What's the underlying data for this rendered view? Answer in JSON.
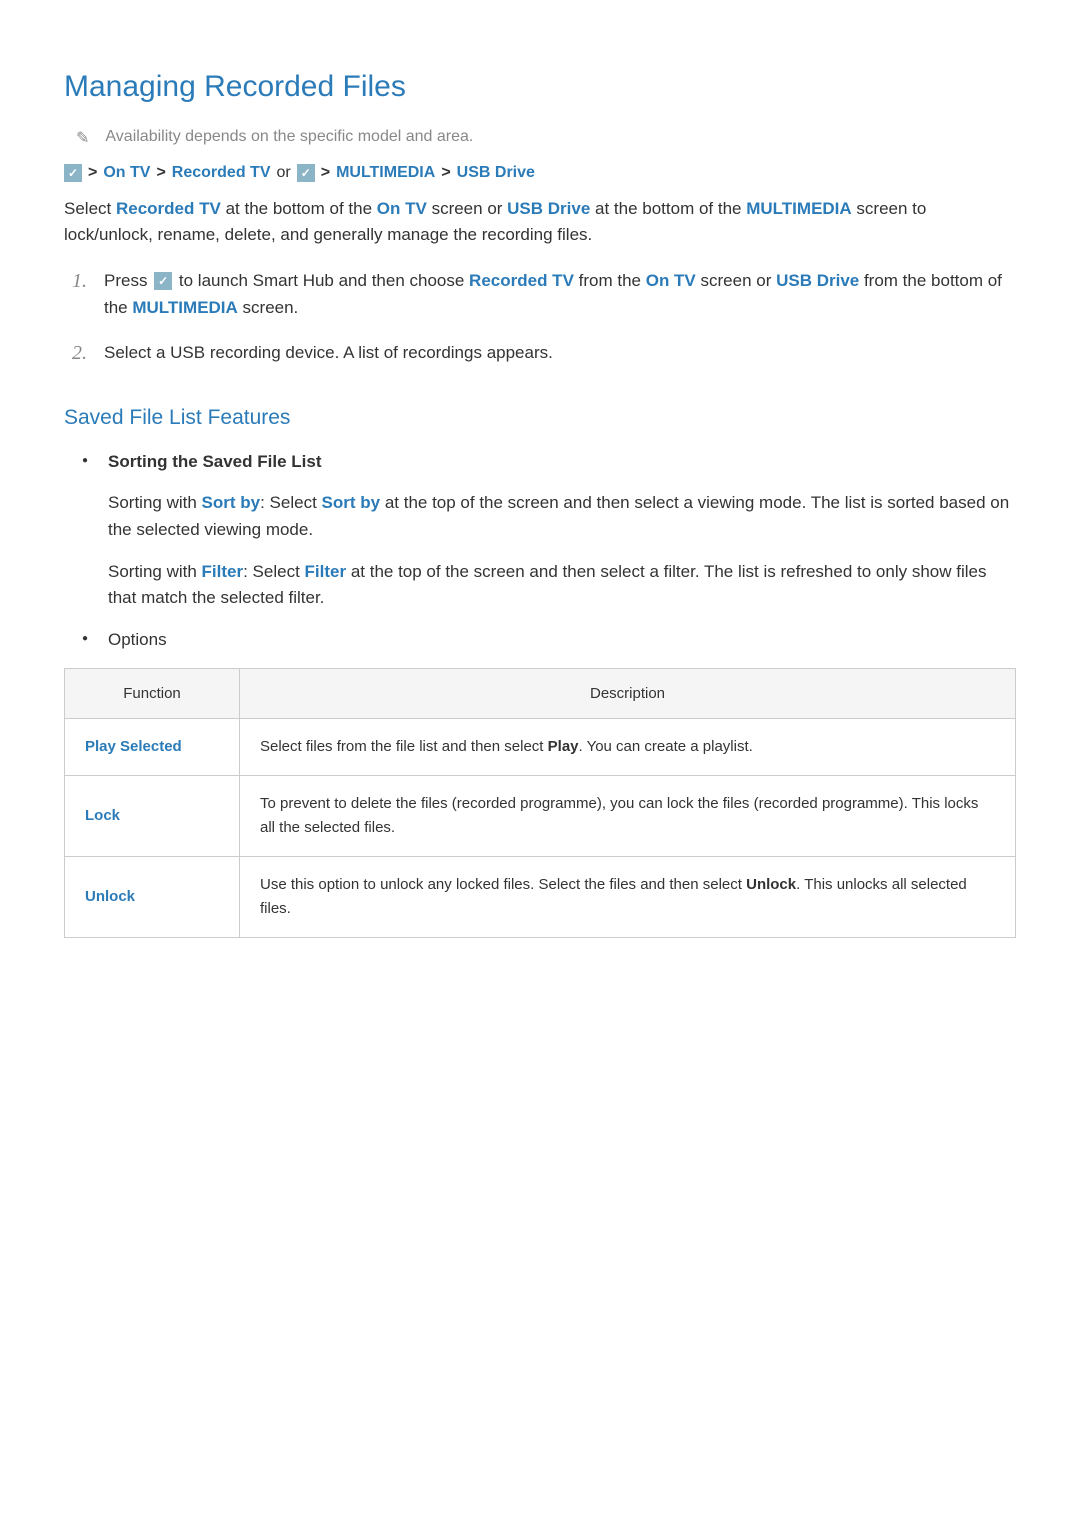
{
  "title": "Managing Recorded Files",
  "note": "Availability depends on the specific model and area.",
  "breadcrumb": {
    "onTV": "On TV",
    "recordedTV": "Recorded TV",
    "or": "or",
    "multimedia": "MULTIMEDIA",
    "usbDrive": "USB Drive"
  },
  "intro": {
    "p1a": "Select ",
    "p1b": "Recorded TV",
    "p1c": " at the bottom of the ",
    "p1d": "On TV",
    "p1e": " screen or ",
    "p1f": "USB Drive",
    "p1g": " at the bottom of the ",
    "p1h": "MULTIMEDIA",
    "p1i": " screen to lock/unlock, rename, delete, and generally manage the recording files."
  },
  "steps": {
    "s1a": "Press ",
    "s1b": " to launch Smart Hub and then choose ",
    "s1c": "Recorded TV",
    "s1d": " from the ",
    "s1e": "On TV",
    "s1f": " screen or ",
    "s1g": "USB Drive",
    "s1h": " from the bottom of the ",
    "s1i": "MULTIMEDIA",
    "s1j": " screen.",
    "s2": "Select a USB recording device. A list of recordings appears."
  },
  "section2": "Saved File List Features",
  "bullets": {
    "sortingHead": "Sorting the Saved File List",
    "sort1a": "Sorting with ",
    "sort1b": "Sort by",
    "sort1c": ": Select ",
    "sort1d": "Sort by",
    "sort1e": " at the top of the screen and then select a viewing mode. The list is sorted based on the selected viewing mode.",
    "sort2a": "Sorting with ",
    "sort2b": "Filter",
    "sort2c": ": Select ",
    "sort2d": "Filter",
    "sort2e": " at the top of the screen and then select a filter. The list is refreshed to only show files that match the selected filter.",
    "optionsHead": "Options"
  },
  "table": {
    "h1": "Function",
    "h2": "Description",
    "r1n": "Play Selected",
    "r1a": "Select files from the file list and then select ",
    "r1b": "Play",
    "r1c": ". You can create a playlist.",
    "r2n": "Lock",
    "r2d": "To prevent to delete the files (recorded programme), you can lock the files (recorded programme). This locks all the selected files.",
    "r3n": "Unlock",
    "r3a": "Use this option to unlock any locked files. Select the files and then select ",
    "r3b": "Unlock",
    "r3c": ". This unlocks all selected files."
  }
}
